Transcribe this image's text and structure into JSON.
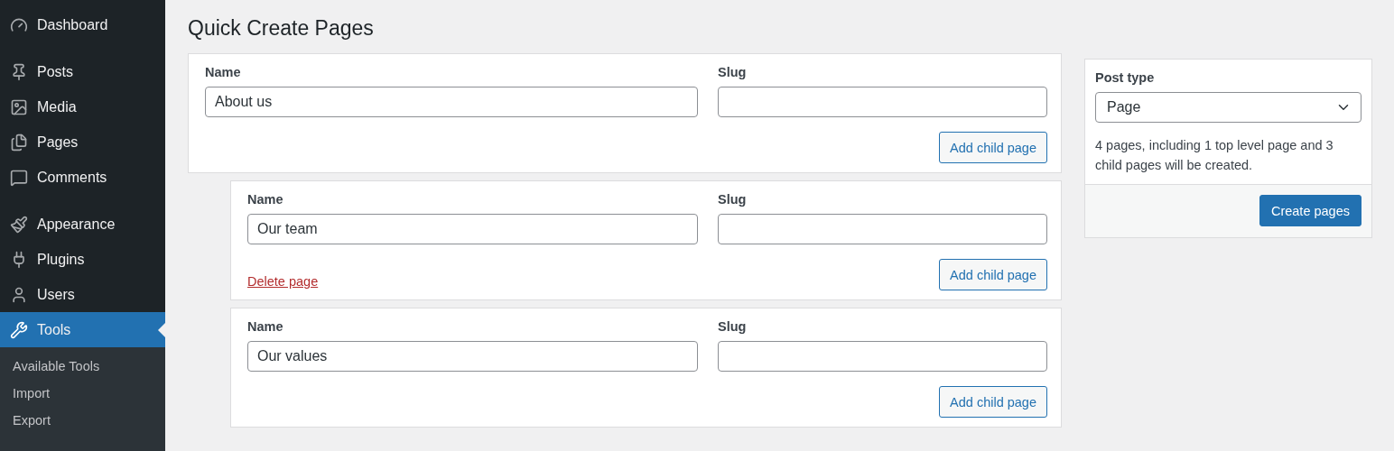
{
  "sidebar": {
    "items": [
      {
        "label": "Dashboard",
        "selected": false,
        "group_end": true
      },
      {
        "label": "Posts",
        "selected": false,
        "group_end": false
      },
      {
        "label": "Media",
        "selected": false,
        "group_end": false
      },
      {
        "label": "Pages",
        "selected": false,
        "group_end": false
      },
      {
        "label": "Comments",
        "selected": false,
        "group_end": true
      },
      {
        "label": "Appearance",
        "selected": false,
        "group_end": false
      },
      {
        "label": "Plugins",
        "selected": false,
        "group_end": false
      },
      {
        "label": "Users",
        "selected": false,
        "group_end": false
      },
      {
        "label": "Tools",
        "selected": true,
        "group_end": false
      }
    ],
    "submenu": [
      "Available Tools",
      "Import",
      "Export"
    ]
  },
  "title": "Quick Create Pages",
  "pages": [
    {
      "name_label": "Name",
      "name": "About us",
      "slug_label": "Slug",
      "add_button": "Add child page",
      "children": [
        {
          "name_label": "Name",
          "name": "Our team",
          "slug_label": "Slug",
          "add_button": "Add child page",
          "delete_link": "Delete page"
        },
        {
          "name_label": "Name",
          "name": "Our values",
          "slug_label": "Slug",
          "add_button": "Add child page"
        }
      ]
    }
  ],
  "panel": {
    "label": "Post type",
    "value": "Page",
    "summary": "4 pages, including 1 top level page and 3 child pages will be created.",
    "button": "Create pages"
  }
}
